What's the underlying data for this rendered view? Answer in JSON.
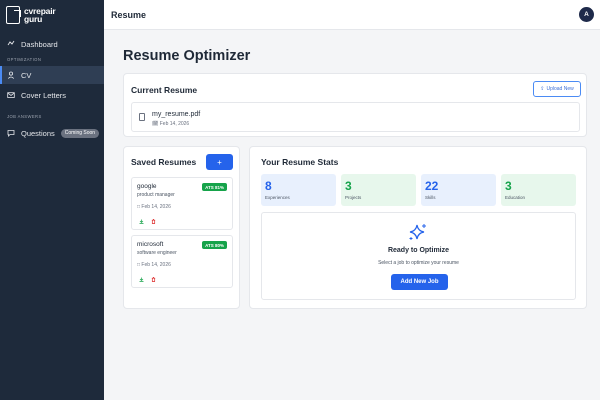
{
  "brand": {
    "name_line1": "cvrepair",
    "name_line2": "guru"
  },
  "sidebar": {
    "dashboard_label": "Dashboard",
    "section_optimization": "OPTIMIZATION",
    "cv_label": "CV",
    "cover_letters_label": "Cover Letters",
    "section_job_answers": "JOB ANSWERS",
    "questions_label": "Questions",
    "coming_soon": "Coming Soon"
  },
  "topbar": {
    "title": "Resume",
    "avatar_initial": "A"
  },
  "page": {
    "title": "Resume Optimizer"
  },
  "current_resume": {
    "title": "Current Resume",
    "upload_label": "Upload New",
    "file_name": "my_resume.pdf",
    "file_date": "Feb 14, 2026"
  },
  "saved_resumes": {
    "title": "Saved Resumes",
    "add_label": "+",
    "items": [
      {
        "company": "google",
        "role": "product manager",
        "date": "Feb 14, 2026",
        "ats": "ATS 81%"
      },
      {
        "company": "microsoft",
        "role": "software engineer",
        "date": "Feb 14, 2026",
        "ats": "ATS 80%"
      }
    ]
  },
  "stats": {
    "title": "Your Resume Stats",
    "items": [
      {
        "value": "8",
        "label": "Experiences",
        "color": "#2563eb",
        "bg": "#e8f0fd"
      },
      {
        "value": "3",
        "label": "Projects",
        "color": "#16a34a",
        "bg": "#e7f7ec"
      },
      {
        "value": "22",
        "label": "Skills",
        "color": "#2563eb",
        "bg": "#e8f0fd"
      },
      {
        "value": "3",
        "label": "Education",
        "color": "#16a34a",
        "bg": "#e7f7ec"
      }
    ]
  },
  "optimize": {
    "title": "Ready to Optimize",
    "subtitle": "Select a job to optimize your resume",
    "button_label": "Add New Job"
  },
  "icons": [
    "dashboard-icon",
    "user-icon",
    "mail-icon",
    "chat-icon",
    "upload-icon",
    "file-icon",
    "calendar-icon",
    "download-icon",
    "trash-icon",
    "sparkle-icon"
  ]
}
